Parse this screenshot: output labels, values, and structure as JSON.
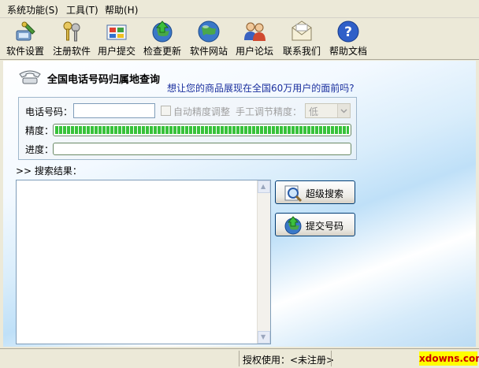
{
  "menu": [
    {
      "label": "系统功能(S)"
    },
    {
      "label": "工具(T)"
    },
    {
      "label": "帮助(H)"
    }
  ],
  "toolbar": [
    {
      "label": "软件设置",
      "icon": "settings-icon"
    },
    {
      "label": "注册软件",
      "icon": "keys-icon"
    },
    {
      "label": "用户提交",
      "icon": "submit-icon"
    },
    {
      "label": "检查更新",
      "icon": "update-globe-icon"
    },
    {
      "label": "软件网站",
      "icon": "globe-icon"
    },
    {
      "label": "用户论坛",
      "icon": "forum-users-icon"
    },
    {
      "label": "联系我们",
      "icon": "envelope-icon"
    },
    {
      "label": "帮助文档",
      "icon": "help-icon"
    }
  ],
  "main": {
    "title": "全国电话号码归属地查询",
    "promo": "想让您的商品展现在全国60万用户的面前吗?",
    "phone_label": "电话号码：",
    "phone_value": "",
    "auto_precision_label": "自动精度调整",
    "manual_precision_label": "手工调节精度：",
    "precision_select": "低",
    "precision_label": "精度：",
    "precision_fill": 1.0,
    "progress_label": "进度：",
    "progress_fill": 0.0,
    "results_label": ">> 搜索结果：",
    "super_search_label": "超级搜索",
    "submit_number_label": "提交号码"
  },
  "status": {
    "license": "授权使用：<未注册>",
    "watermark": "xdowns.com"
  },
  "colors": {
    "accent": "#1a2f9e",
    "progress_green": "#37c23a",
    "watermark_bg": "#ffff00",
    "watermark_text": "#cc0000"
  }
}
